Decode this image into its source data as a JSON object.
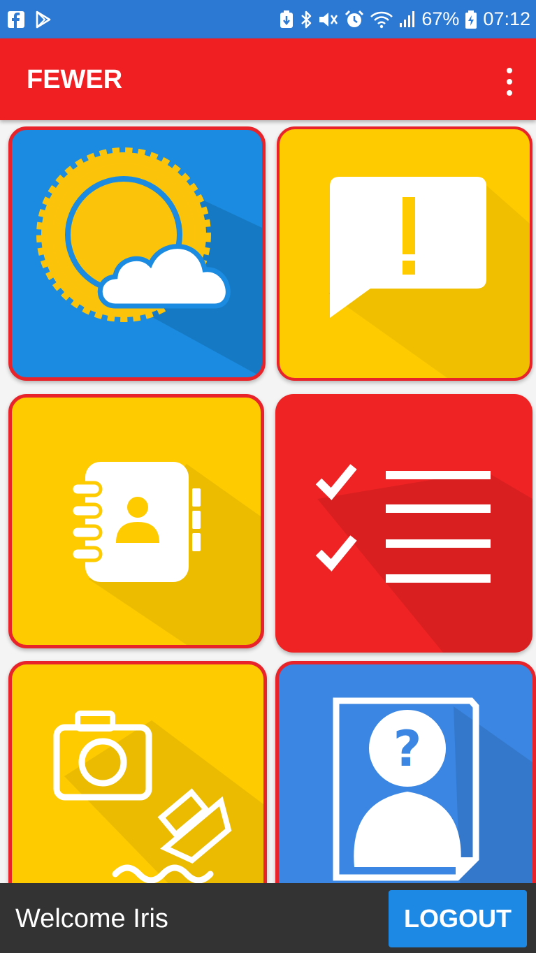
{
  "status_bar": {
    "battery_percent": "67%",
    "time": "07:12",
    "icons": [
      "facebook-icon",
      "play-store-icon",
      "battery-saver-icon",
      "bluetooth-icon",
      "mute-icon",
      "alarm-icon",
      "wifi-icon",
      "signal-icon",
      "battery-icon"
    ]
  },
  "app_bar": {
    "title": "FEWER",
    "menu_icon": "more-vert-icon"
  },
  "tiles": [
    {
      "icon": "weather-icon",
      "color": "#1a8be0"
    },
    {
      "icon": "alert-message-icon",
      "color": "#fecb00"
    },
    {
      "icon": "contacts-book-icon",
      "color": "#fecb00"
    },
    {
      "icon": "checklist-icon",
      "color": "#f02324"
    },
    {
      "icon": "photo-report-icon",
      "color": "#fecb00"
    },
    {
      "icon": "missing-person-icon",
      "color": "#3a86e2"
    }
  ],
  "bottom_bar": {
    "welcome": "Welcome Iris",
    "logout_label": "LOGOUT"
  },
  "colors": {
    "status_bar": "#2c79d4",
    "app_bar": "#f01f22",
    "tile_border": "#e8232a",
    "logout_button": "#1e88e5",
    "bottom_bar": "#333333"
  }
}
